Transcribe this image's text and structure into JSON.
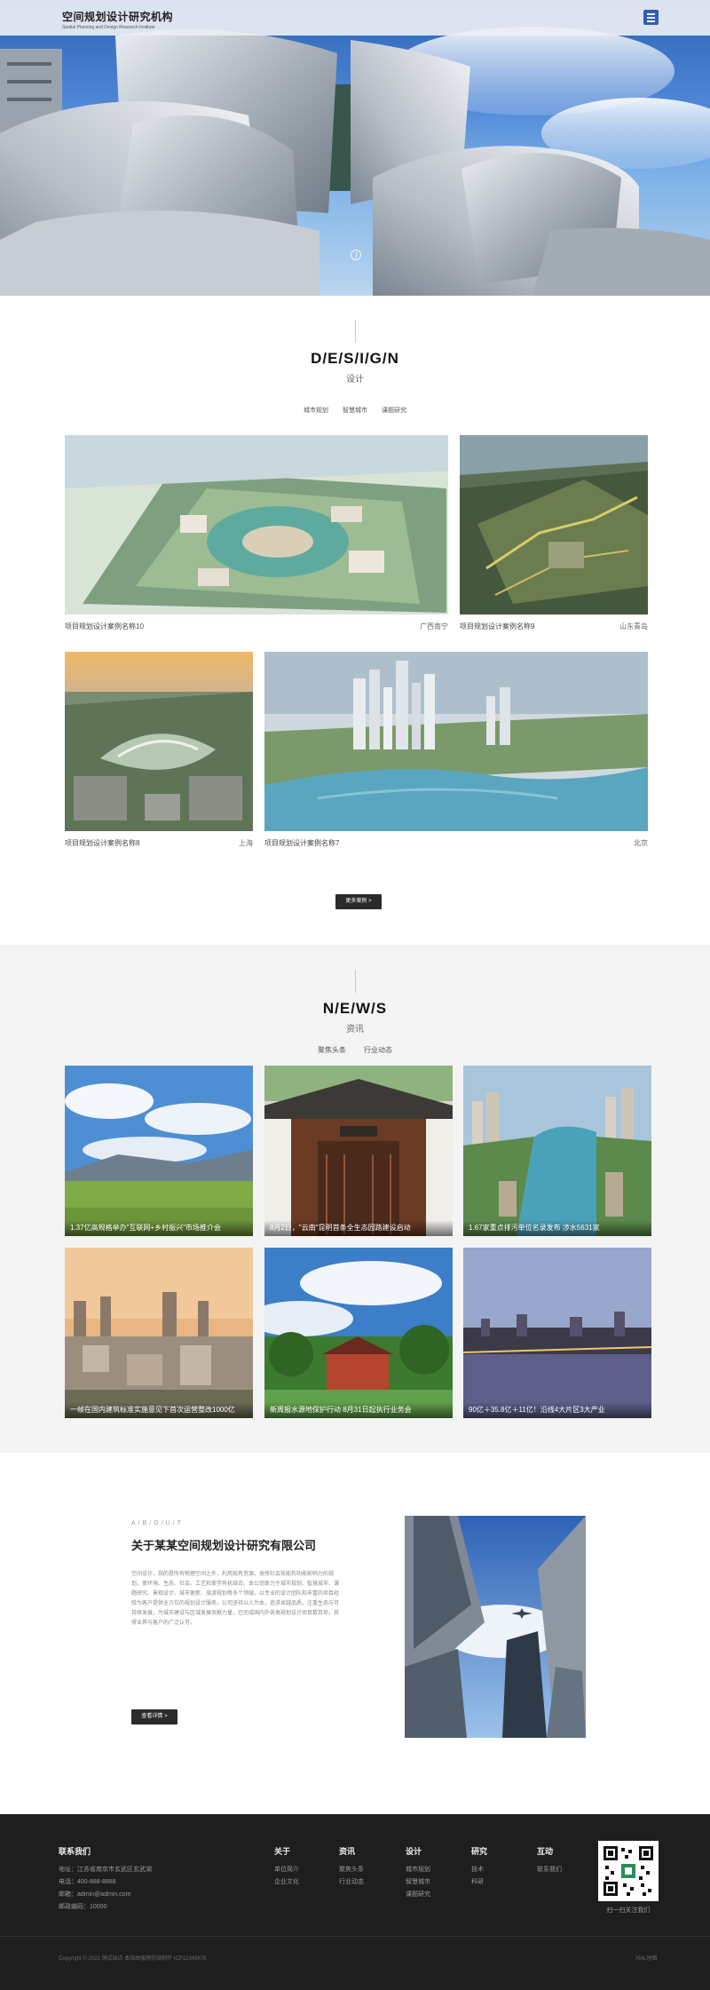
{
  "header": {
    "logo_title": "空间规划设计研究机构",
    "logo_subtitle": "Spatial Planning and Design Research Institute"
  },
  "design": {
    "title": "D/E/S/I/G/N",
    "subtitle": "设计",
    "tabs": [
      "城市规划",
      "智慧城市",
      "课题研究"
    ],
    "cards": [
      {
        "name": "项目规划设计案例名称10",
        "location": "广西南宁"
      },
      {
        "name": "项目规划设计案例名称9",
        "location": "山东青岛"
      },
      {
        "name": "项目规划设计案例名称8",
        "location": "上海"
      },
      {
        "name": "项目规划设计案例名称7",
        "location": "北京"
      }
    ],
    "more_label": "更多案例 >"
  },
  "news": {
    "title": "N/E/W/S",
    "subtitle": "资讯",
    "tabs": [
      "聚焦头条",
      "行业动态"
    ],
    "items": [
      "1.37亿高规格举办\"互联网+乡村振兴\"市场推介会",
      "8月2日，\"云南\"昆明首条全生态园路建设启动",
      "1.67家重点排污单位名录发布 涉水5631家",
      "一帧在国内建筑标准实施意见下首次运营整改1000亿",
      "新周报水源地保护行动 8月31日起执行业务会",
      "90亿＋35.8亿＋11亿！沿线4大片区3大产业"
    ]
  },
  "about": {
    "label_en": "A/B/O/U/T",
    "title": "关于某某空间规划设计研究有限公司",
    "body": "空间设计，指的是所有物理空间之外，利用现有资源，发挥社会效能和功能影响力的规划，使环境、生态、社会、工艺和美学有机结合。本公司致力于城市规划、智慧城市、课题研究、景观设计、城市更新、旅游规划等多个领域，以专业的设计团队和丰富的项目经验为客户提供全方位的规划设计服务。公司坚持以人为本，追求卓越品质，注重生态与可持续发展，为城市建设与区域发展贡献力量，已完成国内外各类规划设计项目数百项，获得业界与客户的广泛认可。",
    "button_label": "查看详情 >"
  },
  "footer": {
    "contact_head": "联系我们",
    "contact_lines": [
      "地址：江苏省南京市玄武区玄武湖",
      "电话：400-888-8888",
      "邮箱：admin@admin.com",
      "邮政编码：10000"
    ],
    "columns": [
      {
        "head": "关于",
        "links": [
          "单位简介",
          "企业文化"
        ]
      },
      {
        "head": "资讯",
        "links": [
          "聚焦头条",
          "行业动态"
        ]
      },
      {
        "head": "设计",
        "links": [
          "城市规划",
          "智慧城市",
          "课题研究"
        ]
      },
      {
        "head": "研究",
        "links": [
          "技术",
          "科研"
        ]
      },
      {
        "head": "互动",
        "links": [
          "联系我们"
        ]
      }
    ],
    "qr_caption": "扫一扫关注我们",
    "copyright": "Copyright © 2022 测试站点 本站由骏网仿站制作 ICP12345678",
    "sitemap": "XML地图"
  },
  "colors": {
    "brand": "#2e5fb3",
    "footer_bg": "#1e1e1e",
    "dark_button": "#2b2b2b"
  }
}
